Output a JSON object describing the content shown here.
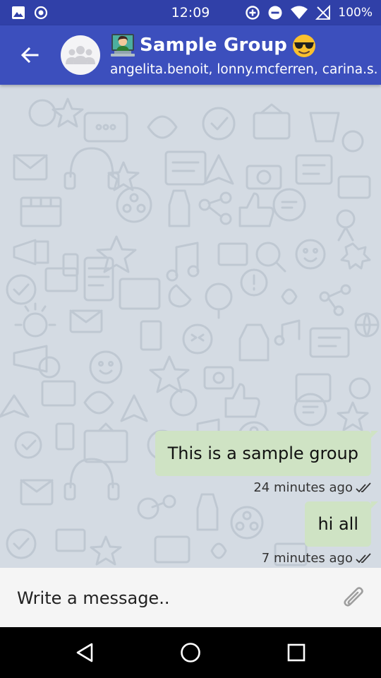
{
  "status_bar": {
    "time": "12:09",
    "battery": "100%",
    "icons": [
      "image-icon",
      "record-icon",
      "data-saver-icon",
      "dnd-icon",
      "wifi-icon",
      "no-signal-icon",
      "battery-icon"
    ]
  },
  "header": {
    "title": "Sample Group",
    "subtitle": "angelita.benoit, lonny.mcferren, carina.s...",
    "back_icon": "arrow-back-icon",
    "avatar_icon": "group-avatar-icon",
    "emoji_left": "person-technologist-emoji",
    "emoji_right": "smiling-face-with-sunglasses-emoji"
  },
  "messages": [
    {
      "text": "This is a sample group",
      "time": "24 minutes ago",
      "status_icon": "double-check-icon"
    },
    {
      "text": "hi all",
      "time": "7 minutes ago",
      "status_icon": "double-check-icon"
    }
  ],
  "composer": {
    "placeholder": "Write a message..",
    "attach_icon": "paperclip-icon"
  },
  "nav": {
    "back_icon": "nav-back-triangle-icon",
    "home_icon": "nav-home-circle-icon",
    "recents_icon": "nav-recents-square-icon"
  },
  "colors": {
    "status_bar": "#3040a8",
    "app_bar": "#3c4fbd",
    "chat_bg": "#d4dbe3",
    "bubble": "#cfe3c4",
    "composer_bg": "#f5f5f5"
  }
}
